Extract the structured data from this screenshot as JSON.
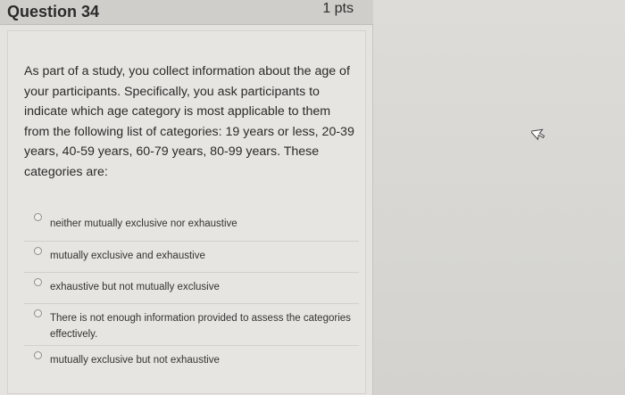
{
  "question": {
    "title": "Question 34",
    "points": "1 pts",
    "prompt": "As part of a study, you collect information about the age of your participants. Specifically, you ask participants to indicate which age category is most applicable to them from the following list of categories: 19 years or less, 20-39 years, 40-59 years, 60-79 years, 80-99 years. These categories are:"
  },
  "answers": [
    {
      "label": "neither mutually exclusive nor exhaustive"
    },
    {
      "label": "mutually exclusive and exhaustive"
    },
    {
      "label": "exhaustive but not mutually exclusive"
    },
    {
      "label": "There is not enough information provided to assess the categories effectively."
    },
    {
      "label": "mutually exclusive but not exhaustive"
    }
  ],
  "icons": {
    "cursor": "mouse-pointer-icon"
  }
}
